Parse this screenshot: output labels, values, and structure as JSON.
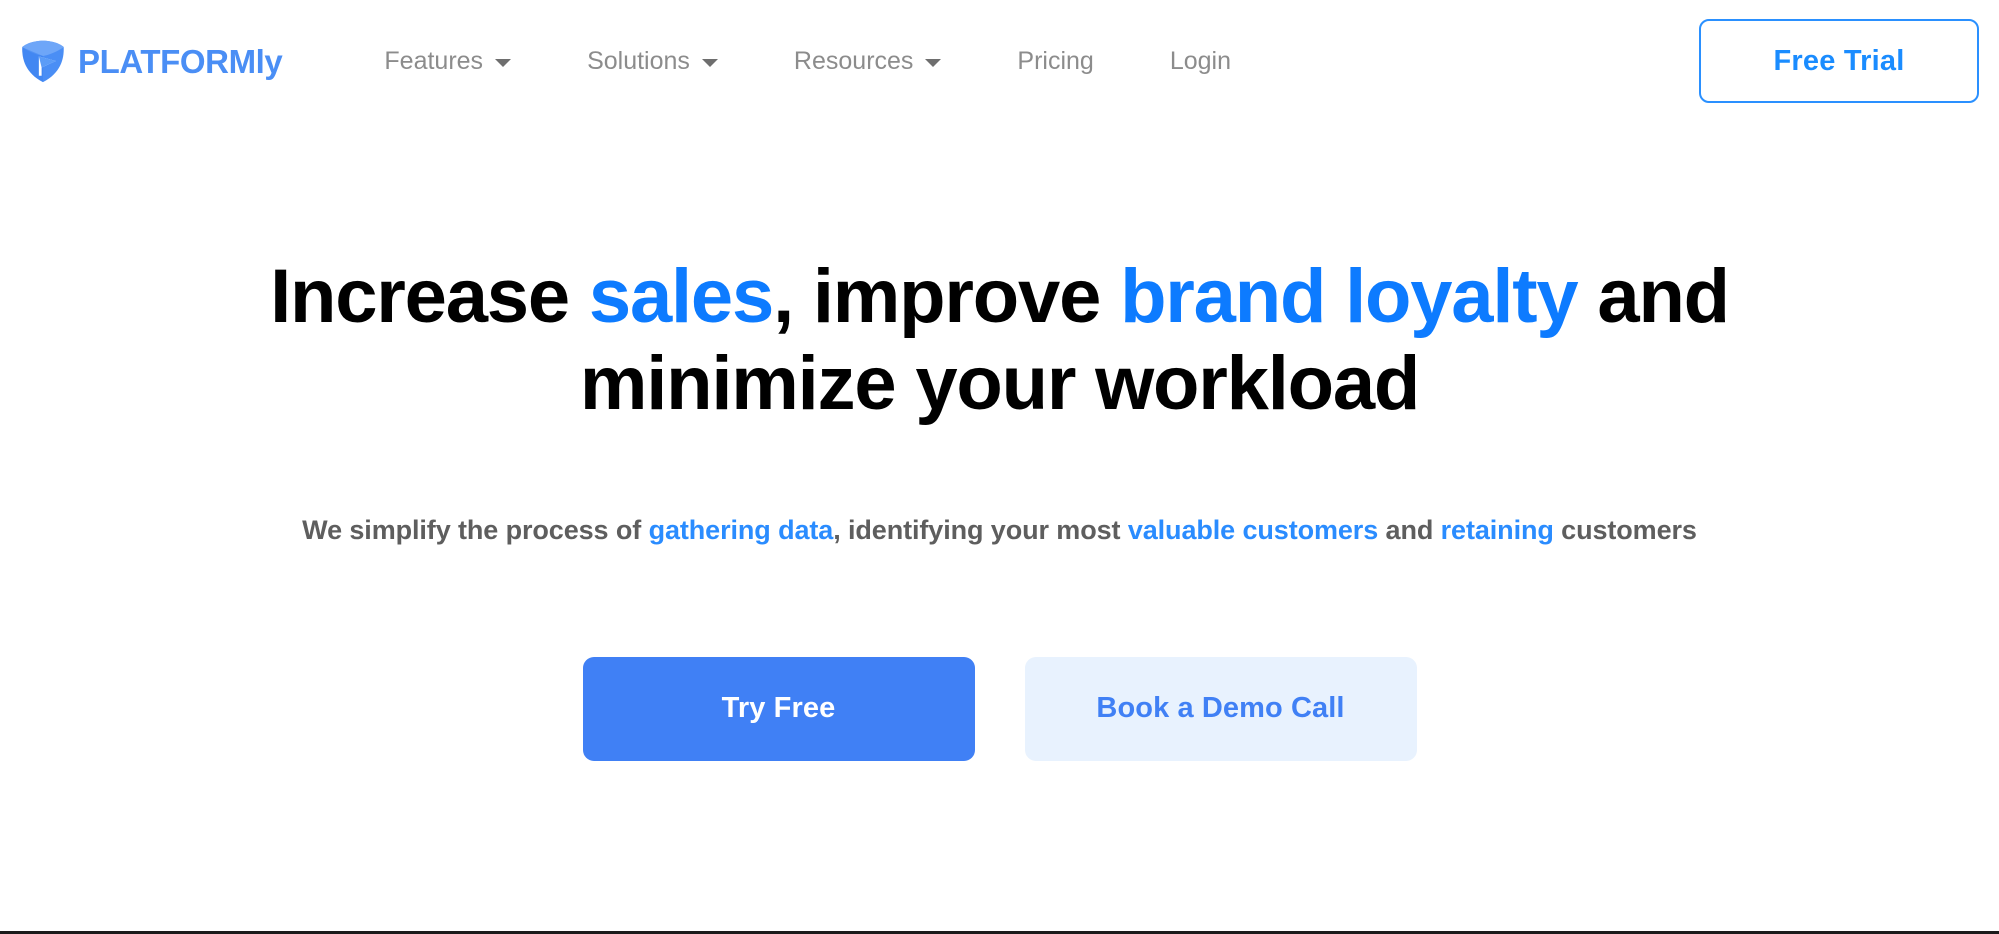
{
  "brand": {
    "name": "PLATFORMly",
    "logo_icon": "shield-play-logo",
    "logo_color": "#4a8ef5"
  },
  "nav": {
    "items": [
      {
        "label": "Features",
        "has_dropdown": true,
        "icon": "chevron-down-icon"
      },
      {
        "label": "Solutions",
        "has_dropdown": true,
        "icon": "chevron-down-icon"
      },
      {
        "label": "Resources",
        "has_dropdown": true,
        "icon": "chevron-down-icon"
      },
      {
        "label": "Pricing",
        "has_dropdown": false,
        "icon": ""
      },
      {
        "label": "Login",
        "has_dropdown": false,
        "icon": ""
      }
    ],
    "cta_label": "Free Trial",
    "cta_border_color": "#2a90ff",
    "cta_text_color": "#1a8cff"
  },
  "hero": {
    "headline": {
      "part1": "Increase ",
      "accent1": "sales",
      "part2": ", improve ",
      "accent2": "brand loyalty",
      "part3": " and minimize your workload"
    },
    "subheadline": {
      "part1": "We simplify the process of ",
      "accent1": "gathering data",
      "part2": ", identifying your most ",
      "accent2": "valuable customers",
      "part3": " and ",
      "accent3": "retaining",
      "part4": " customers"
    },
    "accent_color": "#0d7bff",
    "subhead_color": "#5e5e5e",
    "buttons": {
      "primary_label": "Try Free",
      "primary_bg": "#4080f5",
      "secondary_label": "Book a Demo Call",
      "secondary_bg": "#e8f2fe",
      "secondary_text": "#4080f5"
    }
  }
}
